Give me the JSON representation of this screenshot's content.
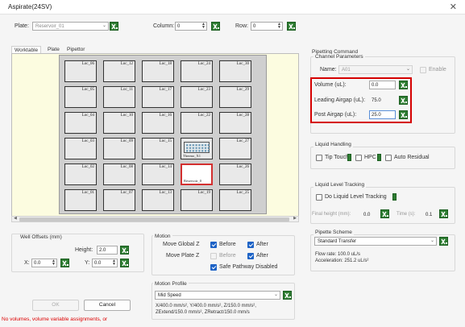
{
  "window": {
    "title": "Aspirate(24SV)",
    "close_glyph": "✕"
  },
  "top": {
    "plate_label": "Plate:",
    "plate_value": "Reservoir_01",
    "column_label": "Column:",
    "column_value": "0",
    "row_label": "Row:",
    "row_value": "0"
  },
  "tabs": [
    {
      "label": "Worktable"
    },
    {
      "label": "Plate"
    },
    {
      "label": "Pipettor"
    }
  ],
  "worktable": {
    "locations": [
      {
        "label": "Loc_06"
      },
      {
        "label": "Loc_12"
      },
      {
        "label": "Loc_18"
      },
      {
        "label": "Loc_24"
      },
      {
        "label": "Loc_30"
      },
      {
        "label": "Loc_05"
      },
      {
        "label": "Loc_11"
      },
      {
        "label": "Loc_17"
      },
      {
        "label": "Loc_23"
      },
      {
        "label": "Loc_29"
      },
      {
        "label": "Loc_04"
      },
      {
        "label": "Loc_10"
      },
      {
        "label": "Loc_16"
      },
      {
        "label": "Loc_22"
      },
      {
        "label": "Loc_28"
      },
      {
        "label": "Loc_03"
      },
      {
        "label": "Loc_09"
      },
      {
        "label": "Loc_15"
      },
      {
        "label": ""
      },
      {
        "label": "Loc_27"
      },
      {
        "label": "Loc_02"
      },
      {
        "label": "Loc_08"
      },
      {
        "label": "Loc_14"
      },
      {
        "label": ""
      },
      {
        "label": "Loc_26"
      },
      {
        "label": "Loc_01"
      },
      {
        "label": "Loc_07"
      },
      {
        "label": "Loc_13"
      },
      {
        "label": "Loc_19"
      },
      {
        "label": "Loc_25"
      }
    ],
    "plate_item_name": "Thermo_X1",
    "reservoir_item_name": "Reservoir_0"
  },
  "pipetting_command": {
    "title": "Pipetting Command",
    "channel_title": "Channel Parameters",
    "name_label": "Name:",
    "name_value": "A01",
    "enable_label": "Enable",
    "volume_label": "Volume (uL):",
    "volume_value": "0.0",
    "leading_label": "Leading Airgap (uL):",
    "leading_value": "75.0",
    "post_label": "Post Airgap (uL):",
    "post_value": "25.0"
  },
  "liquid_handling": {
    "title": "Liquid Handling",
    "tip_touch": "Tip Touch",
    "hpc": "HPC",
    "auto_residual": "Auto Residual"
  },
  "liquid_level": {
    "title": "Liquid Level Tracking",
    "do_tracking": "Do Liquid Level Tracking",
    "final_height_label": "Final height (mm):",
    "final_height_value": "0.0",
    "time_label": "Time (s):",
    "time_value": "0.1"
  },
  "pipette_scheme": {
    "title": "Pipette Scheme",
    "value": "Standard Transfer",
    "flow_rate": "Flow rate: 100.0 uL/s",
    "acceleration": "Acceleration: 251.2 uL/s²"
  },
  "well_offsets": {
    "title": "Well Offsets (mm)",
    "height_label": "Height:",
    "height_value": "2.0",
    "x_label": "X:",
    "x_value": "0.0",
    "y_label": "Y:",
    "y_value": "0.0"
  },
  "motion": {
    "title": "Motion",
    "global_z_label": "Move Global Z",
    "before": "Before",
    "after": "After",
    "plate_z_label": "Move Plate Z",
    "safe_pathway": "Safe Pathway Disabled",
    "global_before": true,
    "global_after": true,
    "plate_before": false,
    "plate_after": true,
    "safe": true
  },
  "motion_profile": {
    "title": "Motion Profile",
    "value": "Mid Speed",
    "line1": "X/400.0 mm/s², Y/400.0 mm/s², Z/150.0 mm/s²,",
    "line2": "ZExtend/150.0 mm/s², ZRetract/150.0 mm/s"
  },
  "buttons": {
    "ok": "OK",
    "cancel": "Cancel"
  },
  "error": "No volumes, volume variable assignments, or",
  "colors": {
    "accent_green": "#2e7d32",
    "highlight_red": "#d50000",
    "check_blue": "#1e63c6",
    "worktable_bg": "#fcfce0"
  }
}
